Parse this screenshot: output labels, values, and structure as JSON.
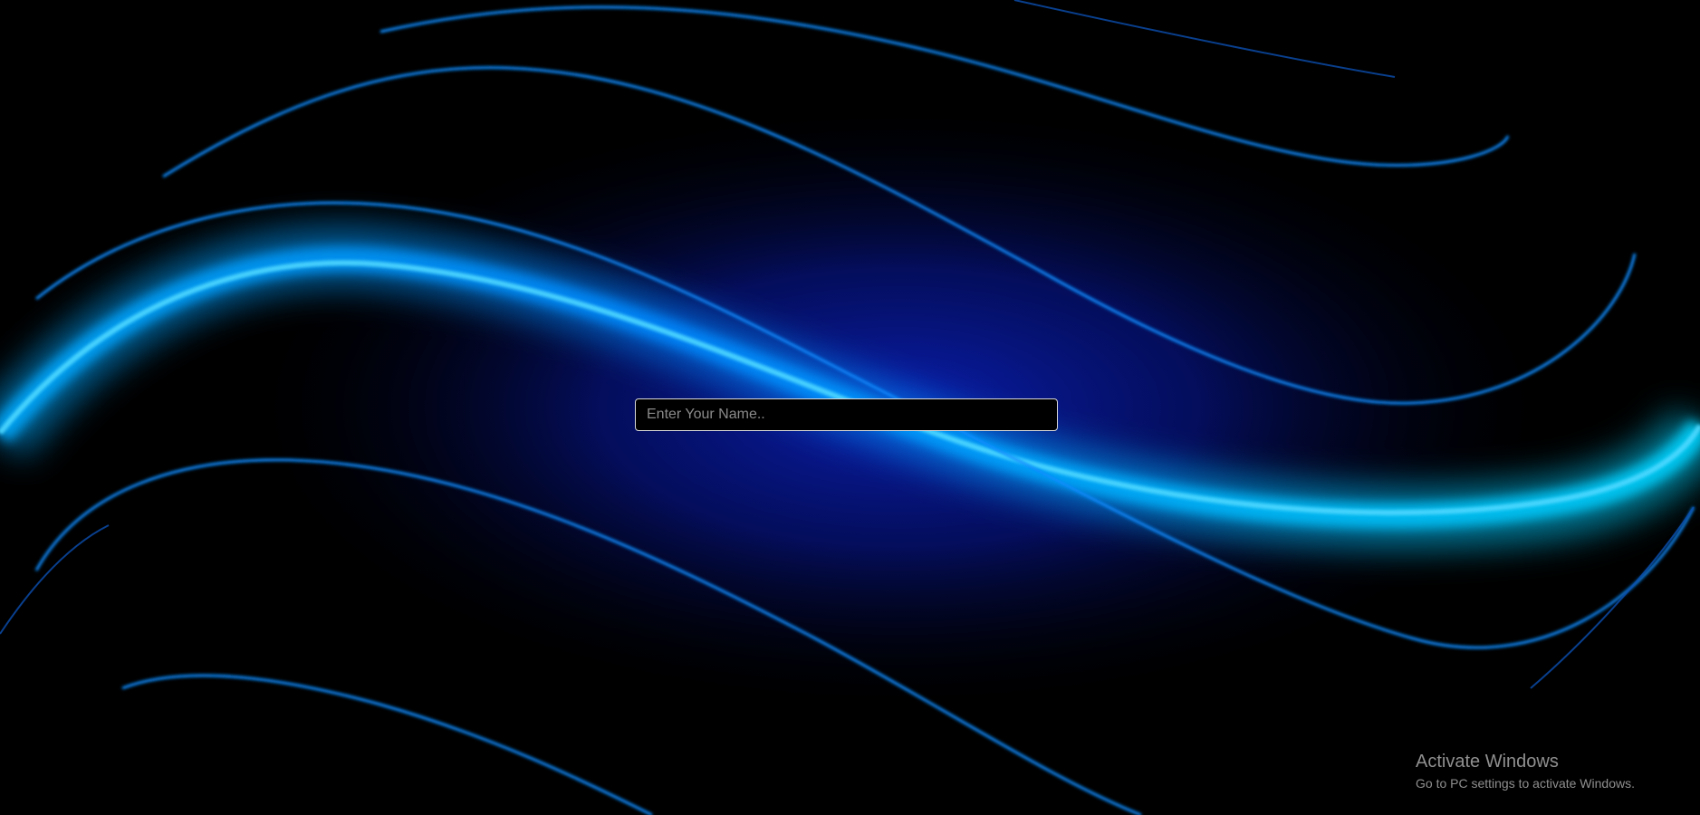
{
  "background": {
    "description_icon": "blue-wave-wallpaper",
    "base_color": "#000000",
    "glow_color": "#00b4ff",
    "deep_blue": "#0a1aa0"
  },
  "name_input": {
    "placeholder": "Enter Your Name..",
    "value": ""
  },
  "activation_watermark": {
    "title": "Activate Windows",
    "subtitle": "Go to PC settings to activate Windows."
  }
}
